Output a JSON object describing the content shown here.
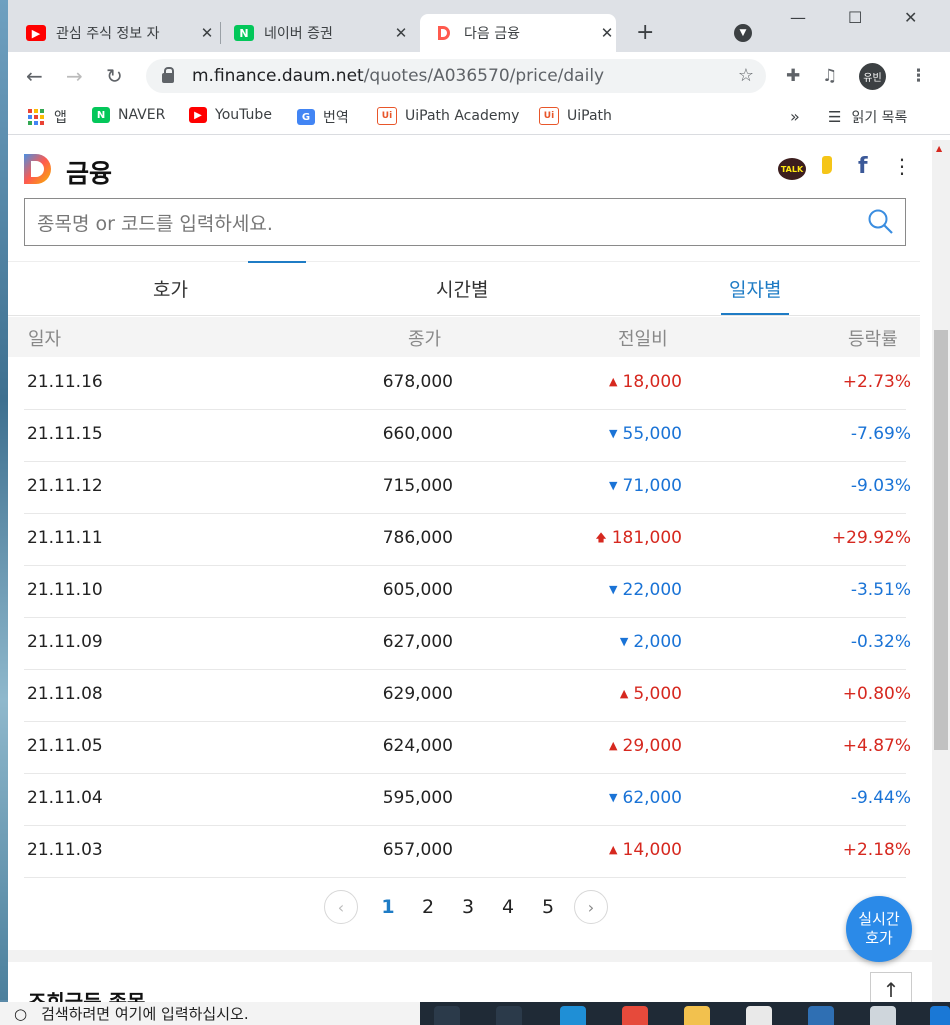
{
  "browser": {
    "tabs": [
      {
        "title": "관심 주식 정보 자",
        "icon": "youtube-icon",
        "color": "#ff0000"
      },
      {
        "title": "네이버 증권",
        "icon": "naver-icon",
        "color": "#03c75a"
      },
      {
        "title": "다음 금융",
        "icon": "daum-icon",
        "color": "#ff5a4e"
      }
    ],
    "url_host": "m.finance.daum.net",
    "url_path": "/quotes/A036570/price/daily",
    "profile": "유빈",
    "bookmarks": [
      {
        "label": "앱",
        "icon": "apps-grid-icon"
      },
      {
        "label": "NAVER",
        "icon": "naver-icon"
      },
      {
        "label": "YouTube",
        "icon": "youtube-icon"
      },
      {
        "label": "번역",
        "icon": "translate-icon"
      },
      {
        "label": "UiPath Academy",
        "icon": "uipath-icon"
      },
      {
        "label": "UiPath",
        "icon": "uipath-icon"
      }
    ],
    "more_bookmarks": "»",
    "reading_list": "읽기 목록"
  },
  "site": {
    "brand": "금융",
    "kakao_label": "TALK",
    "search_placeholder": "종목명 or 코드를 입력하세요."
  },
  "subtabs": [
    "호가",
    "시간별",
    "일자별"
  ],
  "active_subtab": "일자별",
  "table": {
    "headers": [
      "일자",
      "종가",
      "전일비",
      "등락률"
    ],
    "rows": [
      {
        "date": "21.11.16",
        "close": "678,000",
        "diff": "18,000",
        "dir": "up",
        "rate": "+2.73%"
      },
      {
        "date": "21.11.15",
        "close": "660,000",
        "diff": "55,000",
        "dir": "down",
        "rate": "-7.69%"
      },
      {
        "date": "21.11.12",
        "close": "715,000",
        "diff": "71,000",
        "dir": "down",
        "rate": "-9.03%"
      },
      {
        "date": "21.11.11",
        "close": "786,000",
        "diff": "181,000",
        "dir": "limit-up",
        "rate": "+29.92%"
      },
      {
        "date": "21.11.10",
        "close": "605,000",
        "diff": "22,000",
        "dir": "down",
        "rate": "-3.51%"
      },
      {
        "date": "21.11.09",
        "close": "627,000",
        "diff": "2,000",
        "dir": "down",
        "rate": "-0.32%"
      },
      {
        "date": "21.11.08",
        "close": "629,000",
        "diff": "5,000",
        "dir": "up",
        "rate": "+0.80%"
      },
      {
        "date": "21.11.05",
        "close": "624,000",
        "diff": "29,000",
        "dir": "up",
        "rate": "+4.87%"
      },
      {
        "date": "21.11.04",
        "close": "595,000",
        "diff": "62,000",
        "dir": "down",
        "rate": "-9.44%"
      },
      {
        "date": "21.11.03",
        "close": "657,000",
        "diff": "14,000",
        "dir": "up",
        "rate": "+2.18%"
      }
    ]
  },
  "pagination": {
    "pages": [
      "1",
      "2",
      "3",
      "4",
      "5"
    ],
    "current": "1"
  },
  "fab": {
    "line1": "실시간",
    "line2": "호가"
  },
  "next_section_title": "조회급등 종목",
  "taskbar": {
    "search_placeholder": "검색하려면 여기에 입력하십시오."
  },
  "colors": {
    "up": "#d6281f",
    "down": "#1a73d6",
    "accent": "#1f7cc5",
    "fab": "#2b8ae8"
  }
}
